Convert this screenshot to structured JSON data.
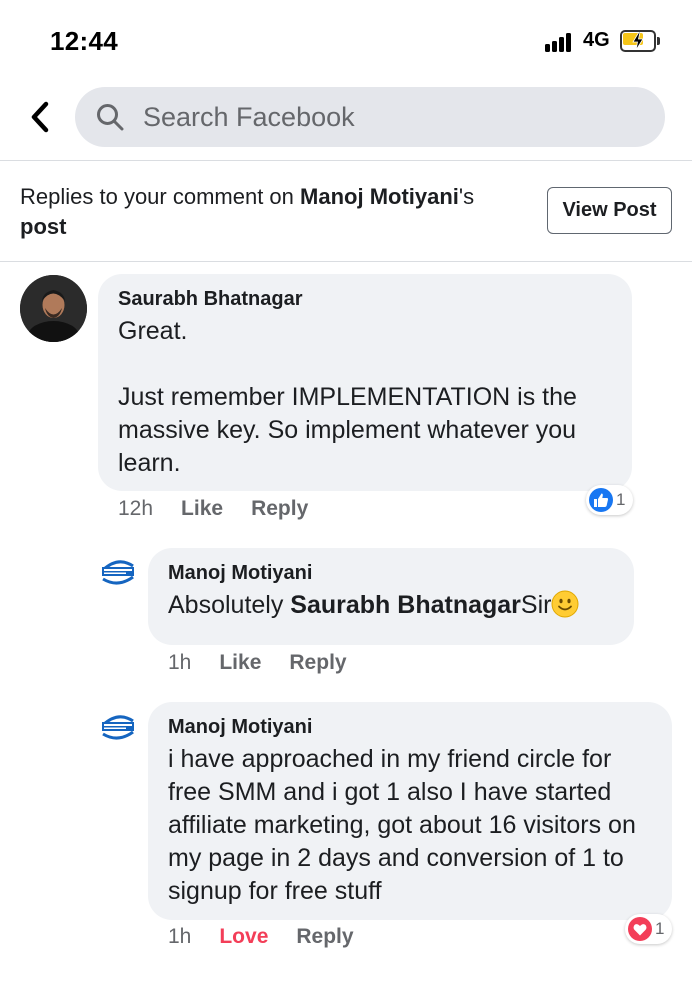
{
  "status_bar": {
    "time": "12:44",
    "network": "4G"
  },
  "search": {
    "placeholder": "Search Facebook",
    "value": ""
  },
  "context": {
    "prefix": "Replies to your comment on ",
    "owner": "Manoj Motiyani",
    "suffix": "'s",
    "post_word": "post",
    "view_post_label": "View Post"
  },
  "comments": [
    {
      "author": "Saurabh Bhatnagar",
      "text": "Great.\n\nJust remember IMPLEMENTATION is the massive key. So implement whatever you learn.",
      "time": "12h",
      "action1": "Like",
      "action2": "Reply",
      "reaction": {
        "icon": "like-icon",
        "count": "1",
        "color": "#1877f2"
      }
    },
    {
      "author": "Manoj Motiyani",
      "text_prefix": "Absolutely ",
      "mention": "Saurabh Bhatnagar",
      "text_suffix": "Sir",
      "emoji": "smiley-emoji",
      "time": "1h",
      "action1": "Like",
      "action2": "Reply"
    },
    {
      "author": "Manoj Motiyani",
      "text": "i have approached in my friend circle for free SMM and i got 1 also I have started affiliate marketing, got about 16 visitors on my page in 2 days and conversion of 1 to signup for free stuff",
      "time": "1h",
      "action1": "Love",
      "action2": "Reply",
      "reaction": {
        "icon": "love-icon",
        "count": "1",
        "color": "#f33e58"
      }
    }
  ]
}
